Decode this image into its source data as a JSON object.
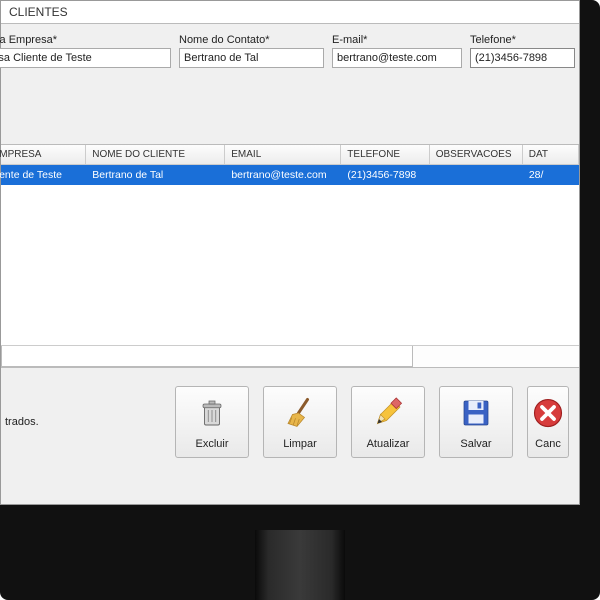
{
  "window": {
    "title": "CLIENTES"
  },
  "form": {
    "empresa": {
      "label": "Nome da Empresa*",
      "value": "Empresa Cliente de Teste"
    },
    "contato": {
      "label": "Nome do Contato*",
      "value": "Bertrano de Tal"
    },
    "email": {
      "label": "E-mail*",
      "value": "bertrano@teste.com"
    },
    "telefone": {
      "label": "Telefone*",
      "value": "(21)3456-7898"
    }
  },
  "grid": {
    "headers": {
      "empresa": "E DA EMPRESA",
      "cliente": "NOME DO CLIENTE",
      "email": "EMAIL",
      "telefone": "TELEFONE",
      "obs": "OBSERVACOES",
      "data": "DAT"
    },
    "rows": [
      {
        "empresa": "esa Cliente de Teste",
        "cliente": "Bertrano de Tal",
        "email": "bertrano@teste.com",
        "telefone": "(21)3456-7898",
        "obs": "",
        "data": "28/"
      }
    ]
  },
  "status": "trados.",
  "buttons": {
    "excluir": "Excluir",
    "limpar": "Limpar",
    "atualizar": "Atualizar",
    "salvar": "Salvar",
    "cancelar": "Canc"
  }
}
